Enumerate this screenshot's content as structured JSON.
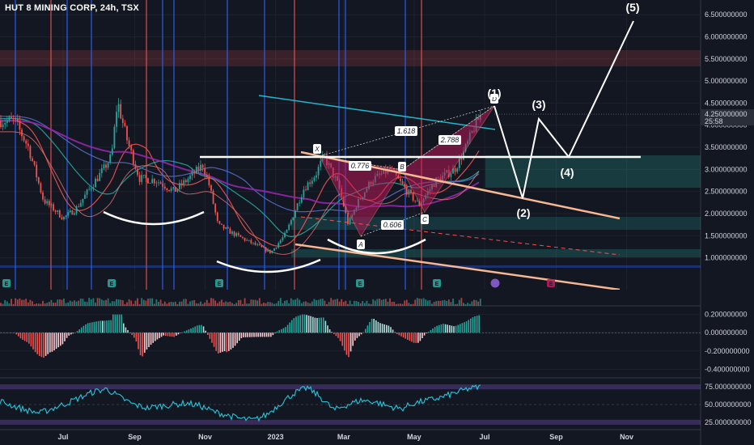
{
  "header": {
    "title": "HUT 8 MINING CORP, 24h, TSX"
  },
  "colors": {
    "background": "#131722",
    "up": "#26a69a",
    "down": "#ef5350",
    "pattern": "#c2185b",
    "channel": "#f7b793",
    "white": "#ffffff",
    "rsi": "#26c6da"
  },
  "price_badge": {
    "value": "4.250000000",
    "countdown": "25:58"
  },
  "chart_data": [
    {
      "type": "candlestick",
      "x_ticks": [
        "Jul",
        "Sep",
        "Nov",
        "2023",
        "Mar",
        "May",
        "Jul",
        "Sep",
        "Nov"
      ],
      "y_ticks": [
        "6.500000000",
        "6.000000000",
        "5.500000000",
        "5.000000000",
        "4.500000000",
        "4.000000000",
        "3.500000000",
        "3.000000000",
        "2.500000000",
        "2.000000000",
        "1.500000000",
        "1.000000000"
      ],
      "ylim": [
        0.7,
        6.65
      ],
      "last_price": 4.25,
      "close_series": [
        {
          "date": "2022-05-20",
          "close": 4.1
        },
        {
          "date": "2022-06-01",
          "close": 3.5
        },
        {
          "date": "2022-06-14",
          "close": 2.3
        },
        {
          "date": "2022-06-25",
          "close": 2.05
        },
        {
          "date": "2022-07-01",
          "close": 1.9
        },
        {
          "date": "2022-07-12",
          "close": 2.1
        },
        {
          "date": "2022-07-25",
          "close": 2.6
        },
        {
          "date": "2022-08-05",
          "close": 3.0
        },
        {
          "date": "2022-08-12",
          "close": 3.3
        },
        {
          "date": "2022-08-17",
          "close": 4.55
        },
        {
          "date": "2022-08-25",
          "close": 3.7
        },
        {
          "date": "2022-09-05",
          "close": 2.8
        },
        {
          "date": "2022-09-20",
          "close": 2.75
        },
        {
          "date": "2022-10-05",
          "close": 2.5
        },
        {
          "date": "2022-10-20",
          "close": 2.85
        },
        {
          "date": "2022-10-30",
          "close": 3.1
        },
        {
          "date": "2022-11-05",
          "close": 2.6
        },
        {
          "date": "2022-11-12",
          "close": 1.75
        },
        {
          "date": "2022-11-25",
          "close": 1.55
        },
        {
          "date": "2022-12-10",
          "close": 1.35
        },
        {
          "date": "2022-12-28",
          "close": 1.12
        },
        {
          "date": "2023-01-10",
          "close": 1.55
        },
        {
          "date": "2023-01-25",
          "close": 2.55
        },
        {
          "date": "2023-02-05",
          "close": 2.9
        },
        {
          "date": "2023-02-12",
          "close": 3.3
        },
        {
          "date": "2023-02-25",
          "close": 2.6
        },
        {
          "date": "2023-03-05",
          "close": 1.75
        },
        {
          "date": "2023-03-12",
          "close": 2.2
        },
        {
          "date": "2023-03-25",
          "close": 2.75
        },
        {
          "date": "2023-04-10",
          "close": 3.0
        },
        {
          "date": "2023-04-25",
          "close": 2.5
        },
        {
          "date": "2023-05-05",
          "close": 2.2
        },
        {
          "date": "2023-05-20",
          "close": 2.75
        },
        {
          "date": "2023-06-05",
          "close": 3.0
        },
        {
          "date": "2023-06-15",
          "close": 3.5
        },
        {
          "date": "2023-06-22",
          "close": 3.95
        },
        {
          "date": "2023-06-28",
          "close": 4.25
        }
      ]
    },
    {
      "type": "bar",
      "name": "macd_histogram",
      "y_ticks": [
        "0.200000000",
        "0.000000000",
        "-0.200000000",
        "-0.400000000"
      ],
      "ylim": [
        -0.45,
        0.25
      ]
    },
    {
      "type": "line",
      "name": "rsi",
      "y_ticks": [
        "75.000000000",
        "50.000000000",
        "25.000000000"
      ],
      "ylim": [
        18,
        82
      ],
      "values": [
        55,
        48,
        42,
        38,
        45,
        52,
        60,
        68,
        72,
        60,
        50,
        45,
        48,
        50,
        52,
        48,
        40,
        35,
        30,
        28,
        36,
        52,
        66,
        74,
        60,
        42,
        50,
        56,
        54,
        48,
        44,
        52,
        56,
        60,
        66,
        72,
        75
      ]
    }
  ],
  "harmonic": {
    "points": [
      "X",
      "A",
      "B",
      "C",
      "D"
    ],
    "ratios": [
      "0.776",
      "1.618",
      "0.606",
      "2.788"
    ]
  },
  "waves": [
    "(1)",
    "(2)",
    "(3)",
    "(4)",
    "(5)"
  ],
  "events": [
    "E",
    "E",
    "E",
    "E",
    "E",
    "E"
  ]
}
